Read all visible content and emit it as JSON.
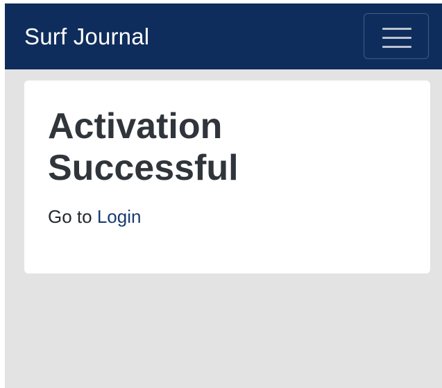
{
  "navbar": {
    "brand": "Surf Journal",
    "menu_icon": "hamburger-menu-icon"
  },
  "main": {
    "title": "Activation Successful",
    "message_prefix": "Go to ",
    "login_link": "Login"
  },
  "colors": {
    "navbar": "#0f2d5c",
    "page_background": "#e3e3e3",
    "card_background": "#ffffff",
    "heading_text": "#30353b",
    "link": "#183b70"
  }
}
